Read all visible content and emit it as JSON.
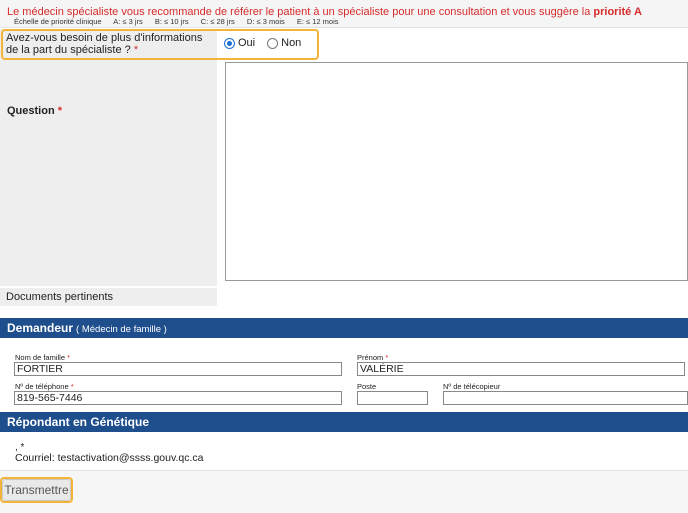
{
  "notice": {
    "message_prefix": "Le médecin spécialiste vous recommande de référer le patient à un spécialiste pour une consultation et vous suggère la ",
    "message_priority": "priorité A",
    "scale_label": "Échelle de priorité clinique",
    "scale_items": [
      "A: ≤ 3 jrs",
      "B: ≤ 10 jrs",
      "C: ≤ 28 jrs",
      "D: ≤ 3 mois",
      "E: ≤ 12 mois"
    ]
  },
  "more_info": {
    "label": "Avez-vous besoin de plus d'informations de la part du spécialiste ?",
    "required_mark": "*",
    "options": [
      {
        "label": "Oui",
        "selected": true
      },
      {
        "label": "Non",
        "selected": false
      }
    ]
  },
  "question": {
    "label": "Question",
    "required_mark": "*",
    "value": ""
  },
  "documents": {
    "label": "Documents pertinents"
  },
  "demandeur": {
    "title": "Demandeur",
    "subtitle": "( Médecin de famille )",
    "fields": {
      "nom_label": "Nom de famille",
      "nom_value": "FORTIER",
      "prenom_label": "Prénom",
      "prenom_value": "VALÉRIE",
      "tel_label": "Nº de téléphone",
      "tel_value": "819-565-7446",
      "poste_label": "Poste",
      "poste_value": "",
      "fax_label": "Nº de télécopieur",
      "fax_value": "",
      "required_mark": "*"
    }
  },
  "repondant": {
    "title": "Répondant en Génétique",
    "line1": ", *",
    "courriel": "Courriel: testactivation@ssss.gouv.qc.ca"
  },
  "footer": {
    "submit_label": "Transmettre"
  },
  "colors": {
    "accent_bar": "#1f4e8c",
    "required": "#d62b2b",
    "highlight": "#f2b53a"
  }
}
